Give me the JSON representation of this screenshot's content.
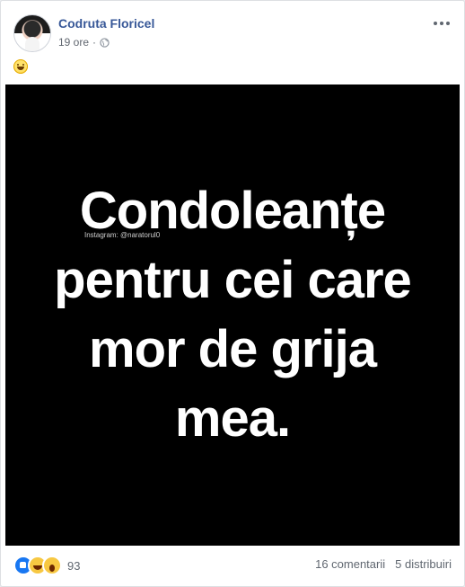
{
  "post": {
    "author": "Codruta Floricel",
    "time": "19 ore",
    "separator": "·",
    "privacy_icon": "globe-icon",
    "status_emoji": "grinning-face-emoji",
    "image": {
      "lines": [
        "Condoleanțe",
        "pentru cei care",
        "mor de grija",
        "mea."
      ],
      "watermark": "Instagram: @naratorul0",
      "background": "#000000",
      "text_color": "#ffffff"
    },
    "reactions": {
      "icons": [
        "like-icon",
        "haha-icon",
        "wow-icon"
      ],
      "count": "93"
    },
    "comments_count": "16 comentarii",
    "shares_count": "5 distribuiri"
  },
  "colors": {
    "author_link": "#385898",
    "meta_text": "#616770",
    "like_blue": "#1877f2",
    "emoji_yellow": "#f7c842"
  }
}
